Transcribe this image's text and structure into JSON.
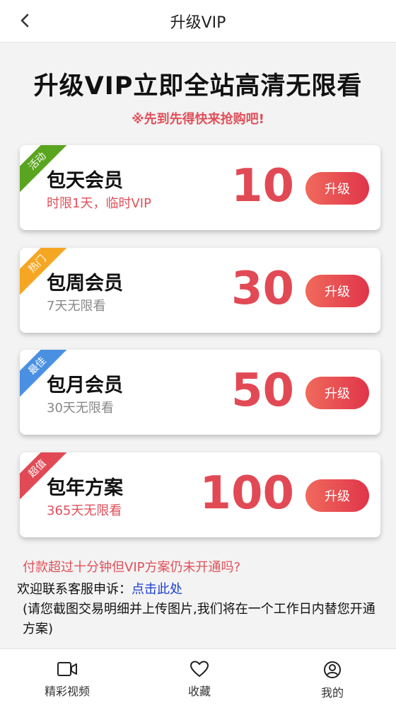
{
  "header": {
    "title": "升级VIP"
  },
  "headline": "升级VIP立即全站高清无限看",
  "subline": "※先到先得快来抢购吧!",
  "plans": [
    {
      "badge": "活动",
      "badge_color": "#5aa51f",
      "title": "包天会员",
      "desc": "时限1天，临时VIP",
      "desc_color": "#e0505a",
      "price": "10",
      "button": "升级"
    },
    {
      "badge": "热门",
      "badge_color": "#f5a623",
      "title": "包周会员",
      "desc": "7天无限看",
      "desc_color": "#888888",
      "price": "30",
      "button": "升级"
    },
    {
      "badge": "最佳",
      "badge_color": "#4a90e2",
      "title": "包月会员",
      "desc": "30天无限看",
      "desc_color": "#888888",
      "price": "50",
      "button": "升级"
    },
    {
      "badge": "超值",
      "badge_color": "#e14a55",
      "title": "包年方案",
      "desc": "365天无限看",
      "desc_color": "#e0505a",
      "price": "100",
      "button": "升级"
    }
  ],
  "notice": {
    "red_line": "付款超过十分钟但VIP方案仍未开通吗?",
    "contact_prefix": "欢迎联系客服申诉：",
    "contact_link": "点击此处",
    "paragraph": "(请您截图交易明细并上传图片,我们将在一个工作日内替您开通方案)"
  },
  "tabbar": {
    "items": [
      {
        "label": "精彩视频",
        "icon": "video-camera-icon"
      },
      {
        "label": "收藏",
        "icon": "heart-icon"
      },
      {
        "label": "我的",
        "icon": "user-icon"
      }
    ]
  }
}
